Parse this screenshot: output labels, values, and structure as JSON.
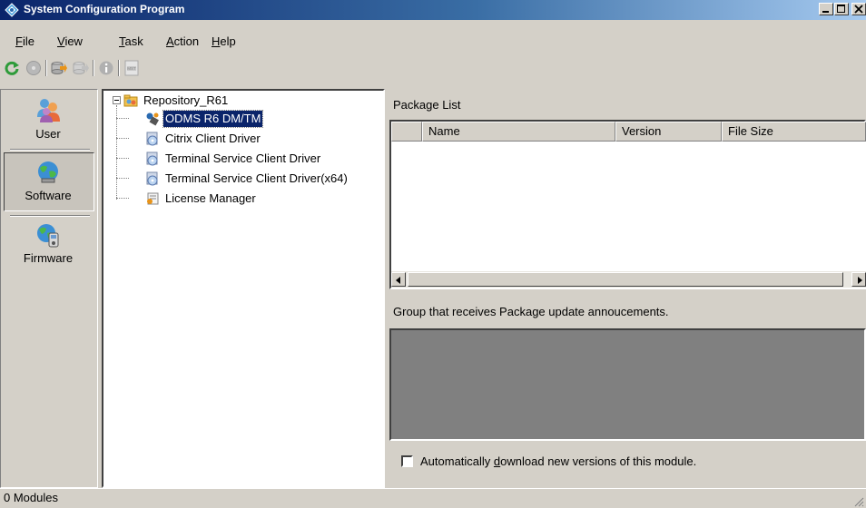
{
  "window": {
    "title": "System Configuration Program",
    "title_gradient": [
      "#0a246a",
      "#a6caf0"
    ]
  },
  "menu": {
    "items": [
      {
        "label": "File",
        "accel": "F"
      },
      {
        "label": "View",
        "accel": "V"
      },
      {
        "label": "Task",
        "accel": "T"
      },
      {
        "label": "Action",
        "accel": "A"
      },
      {
        "label": "Help",
        "accel": "H"
      }
    ]
  },
  "toolbar": {
    "buttons": [
      {
        "icon": "refresh-icon",
        "enabled": true
      },
      {
        "icon": "disc-icon",
        "enabled": false
      },
      {
        "icon": "import-icon",
        "enabled": true
      },
      {
        "icon": "export-icon",
        "enabled": false
      },
      {
        "icon": "info-icon",
        "enabled": false
      },
      {
        "icon": "mst-icon",
        "enabled": false
      }
    ]
  },
  "sidebar": {
    "items": [
      {
        "label": "User",
        "icon": "users-icon",
        "selected": false
      },
      {
        "label": "Software",
        "icon": "software-globe-icon",
        "selected": true
      },
      {
        "label": "Firmware",
        "icon": "firmware-globe-icon",
        "selected": false
      }
    ]
  },
  "tree": {
    "root": {
      "label": "Repository_R61",
      "icon": "repository-icon",
      "expanded": true
    },
    "children": [
      {
        "label": "ODMS R6 DM/TM",
        "icon": "odms-icon",
        "selected": true
      },
      {
        "label": "Citrix Client Driver",
        "icon": "disk-package-icon",
        "selected": false
      },
      {
        "label": "Terminal Service Client Driver",
        "icon": "disk-package-icon",
        "selected": false
      },
      {
        "label": "Terminal Service Client Driver(x64)",
        "icon": "disk-package-icon",
        "selected": false
      },
      {
        "label": "License Manager",
        "icon": "license-icon",
        "selected": false
      }
    ]
  },
  "package_list": {
    "title": "Package List",
    "columns": [
      "",
      "Name",
      "Version",
      "File Size"
    ],
    "rows": []
  },
  "group": {
    "label": "Group that receives Package update annoucements."
  },
  "auto_download": {
    "label": "Automatically download new versions of this module.",
    "accel": "d",
    "checked": false
  },
  "status": {
    "text": "0 Modules"
  }
}
